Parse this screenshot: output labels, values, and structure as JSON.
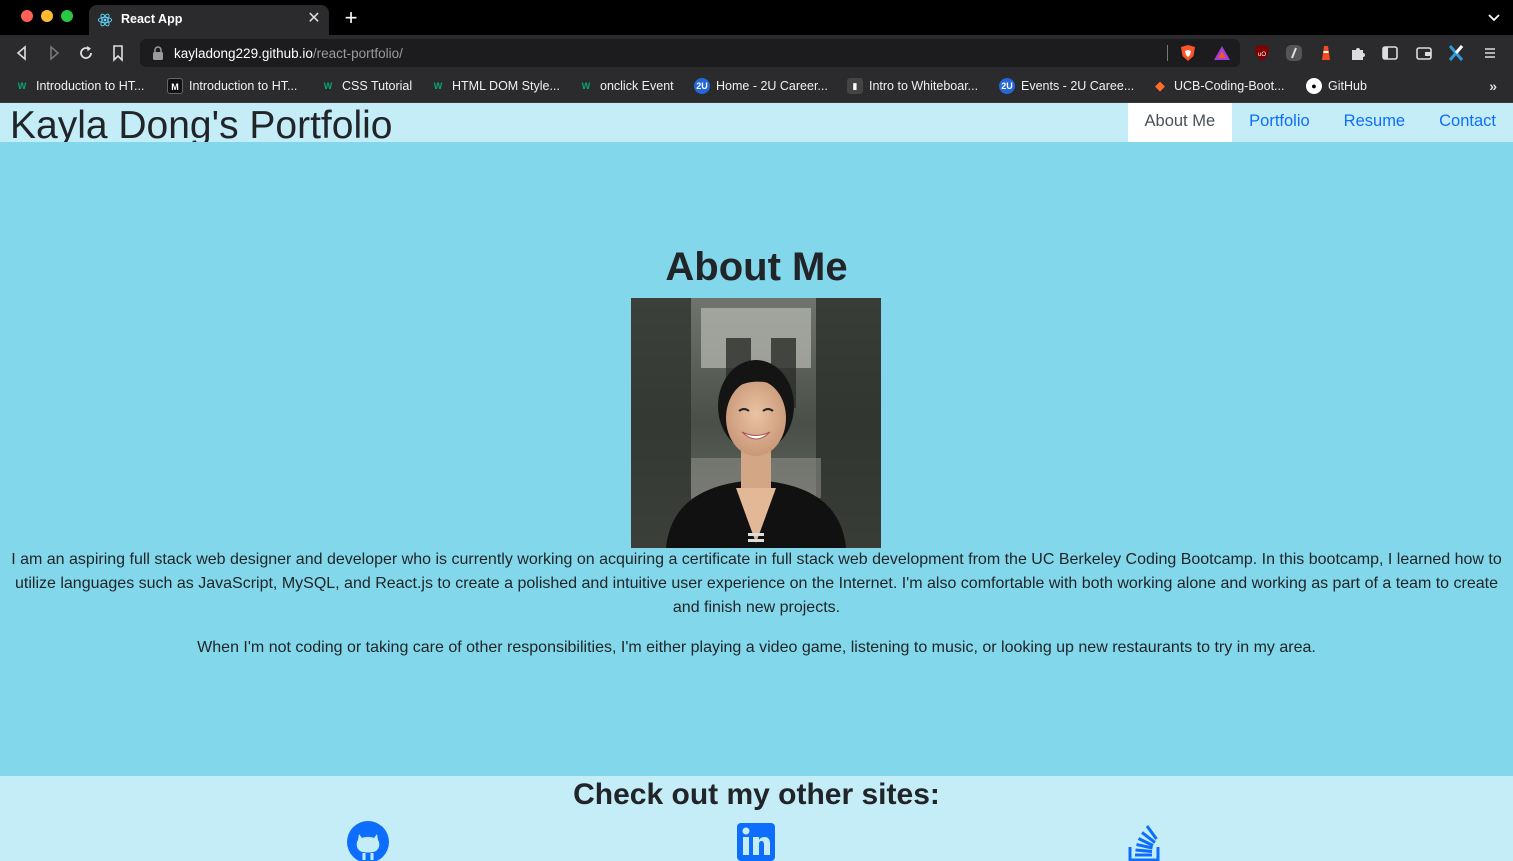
{
  "browser": {
    "tab_title": "React App",
    "url_domain": "kayladong229.github.io",
    "url_path": "/react-portfolio/",
    "bookmarks": [
      {
        "label": "Introduction to HT...",
        "icon": "w3schools-icon"
      },
      {
        "label": "Introduction to HT...",
        "icon": "m-icon"
      },
      {
        "label": "CSS Tutorial",
        "icon": "w3schools-icon"
      },
      {
        "label": "HTML DOM Style...",
        "icon": "w3schools-icon"
      },
      {
        "label": "onclick Event",
        "icon": "w3schools-icon"
      },
      {
        "label": "Home - 2U Career...",
        "icon": "2u-icon"
      },
      {
        "label": "Intro to Whiteboar...",
        "icon": "book-icon"
      },
      {
        "label": "Events - 2U Caree...",
        "icon": "2u-icon"
      },
      {
        "label": "UCB-Coding-Boot...",
        "icon": "gitlab-icon"
      },
      {
        "label": "GitHub",
        "icon": "github-icon"
      }
    ],
    "more_bookmarks": "»"
  },
  "header": {
    "title": "Kayla Dong's Portfolio",
    "nav": [
      "About Me",
      "Portfolio",
      "Resume",
      "Contact"
    ],
    "active_nav": "About Me"
  },
  "about": {
    "heading": "About Me",
    "paragraph1": "I am an aspiring full stack web designer and developer who is currently working on acquiring a certificate in full stack web development from the UC Berkeley Coding Bootcamp. In this bootcamp, I learned how to utilize languages such as JavaScript, MySQL, and React.js to create a polished and intuitive user experience on the Internet. I'm also comfortable with both working alone and working as part of a team to create and finish new projects.",
    "paragraph2": "When I'm not coding or taking care of other responsibilities, I'm either playing a video game, listening to music, or looking up new restaurants to try in my area."
  },
  "footer": {
    "heading": "Check out my other sites:",
    "links": [
      "github-icon",
      "linkedin-icon",
      "stackoverflow-icon"
    ]
  },
  "colors": {
    "header_bg": "#c5edf7",
    "main_bg": "#82d8ea",
    "link": "#0d6efd",
    "text": "#212529"
  }
}
